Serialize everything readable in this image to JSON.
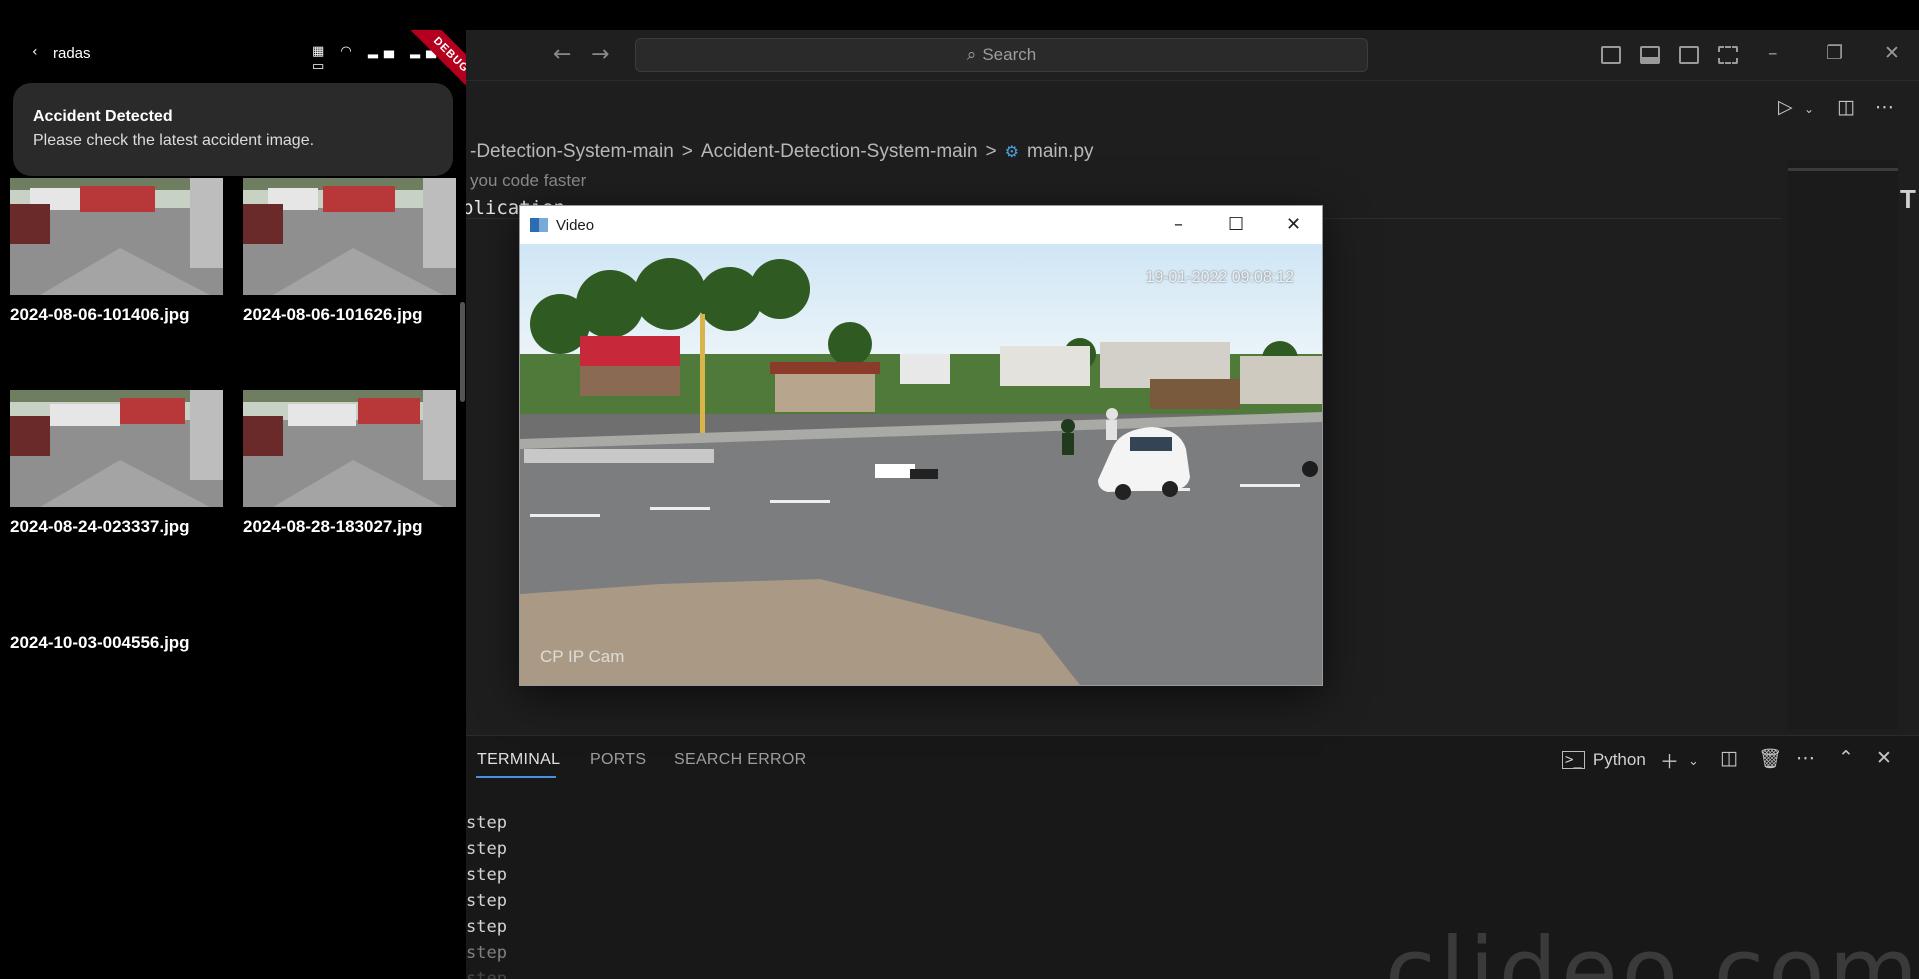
{
  "editor": {
    "search_placeholder": "Search",
    "breadcrumbs": [
      "-Detection-System-main",
      ">",
      "Accident-Detection-System-main",
      ">",
      "main.py"
    ],
    "breadcrumb_file_icon": "python-icon",
    "hint": "you code faster",
    "code_line": "plication",
    "panel_tabs": [
      "TERMINAL",
      "PORTS",
      "SEARCH ERROR"
    ],
    "terminal_profile": "Python",
    "terminal_lines": [
      "step",
      "step",
      "step",
      "step",
      "step",
      "step",
      "step"
    ],
    "watermark": "clideo.com"
  },
  "video_window": {
    "title": "Video",
    "timestamp": "19-01-2022 09:08:12",
    "camera_label": "CP IP Cam"
  },
  "phone": {
    "app_name": "radas",
    "debug_banner": "DEBUG",
    "notification": {
      "title": "Accident Detected",
      "body": "Please check the latest accident image."
    },
    "images": [
      "2024-08-06-101406.jpg",
      "2024-08-06-101626.jpg",
      "2024-08-24-023337.jpg",
      "2024-08-28-183027.jpg",
      "2024-10-03-004556.jpg"
    ]
  },
  "colors": {
    "ide_bg": "#1e1e1e",
    "panel_bg": "#181818",
    "accent": "#4a90e2",
    "debug_ribbon": "#b4001e"
  }
}
